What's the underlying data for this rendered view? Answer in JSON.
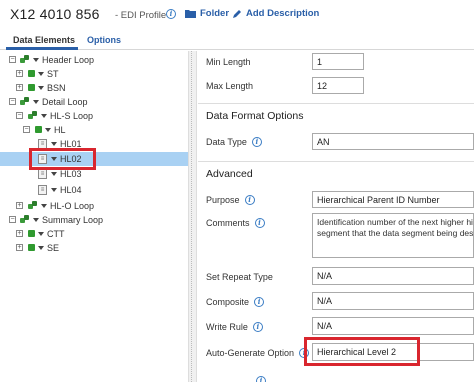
{
  "header": {
    "title": "X12 4010 856",
    "subtitle": "- EDI Profile",
    "info_glyph": "i",
    "folder_label": "Folder",
    "add_description_label": "Add Description"
  },
  "tabs": [
    {
      "label": "Data Elements",
      "active": true
    },
    {
      "label": "Options",
      "active": false
    }
  ],
  "tree": {
    "items": [
      {
        "label": "Header Loop",
        "expander": "⊟",
        "kind": "group"
      },
      {
        "label": "ST",
        "expander": "⊞",
        "kind": "segment"
      },
      {
        "label": "BSN",
        "expander": "⊞",
        "kind": "segment"
      },
      {
        "label": "Detail Loop",
        "expander": "⊟",
        "kind": "group"
      },
      {
        "label": "HL-S Loop",
        "expander": "⊟",
        "kind": "group"
      },
      {
        "label": "HL",
        "expander": "⊟",
        "kind": "segment"
      },
      {
        "label": "HL01",
        "kind": "element"
      },
      {
        "label": "HL02",
        "kind": "element",
        "selected": true
      },
      {
        "label": "HL03",
        "kind": "element"
      },
      {
        "label": "HL04",
        "kind": "element"
      },
      {
        "label": "HL-O Loop",
        "expander": "⊞",
        "kind": "group"
      },
      {
        "label": "Summary Loop",
        "expander": "⊟",
        "kind": "group"
      },
      {
        "label": "CTT",
        "expander": "⊞",
        "kind": "segment"
      },
      {
        "label": "SE",
        "expander": "⊞",
        "kind": "segment"
      }
    ]
  },
  "form": {
    "min_length": {
      "label": "Min Length",
      "value": "1"
    },
    "max_length": {
      "label": "Max Length",
      "value": "12"
    },
    "data_format_title": "Data Format Options",
    "data_type": {
      "label": "Data Type",
      "value": "AN"
    },
    "advanced_title": "Advanced",
    "purpose": {
      "label": "Purpose",
      "value": "Hierarchical Parent ID Number"
    },
    "comments": {
      "label": "Comments",
      "line1": "Identification number of the next higher hi",
      "line2": "segment that the  data segment being desc"
    },
    "set_repeat_type": {
      "label": "Set Repeat Type",
      "value": "N/A"
    },
    "composite": {
      "label": "Composite",
      "value": "N/A"
    },
    "write_rule": {
      "label": "Write Rule",
      "value": "N/A"
    },
    "auto_generate": {
      "label": "Auto-Generate Option",
      "value": "Hierarchical Level 2"
    }
  },
  "colors": {
    "accent": "#2a5fa8",
    "selection": "#a9d1f3",
    "highlight": "#d9262e"
  }
}
